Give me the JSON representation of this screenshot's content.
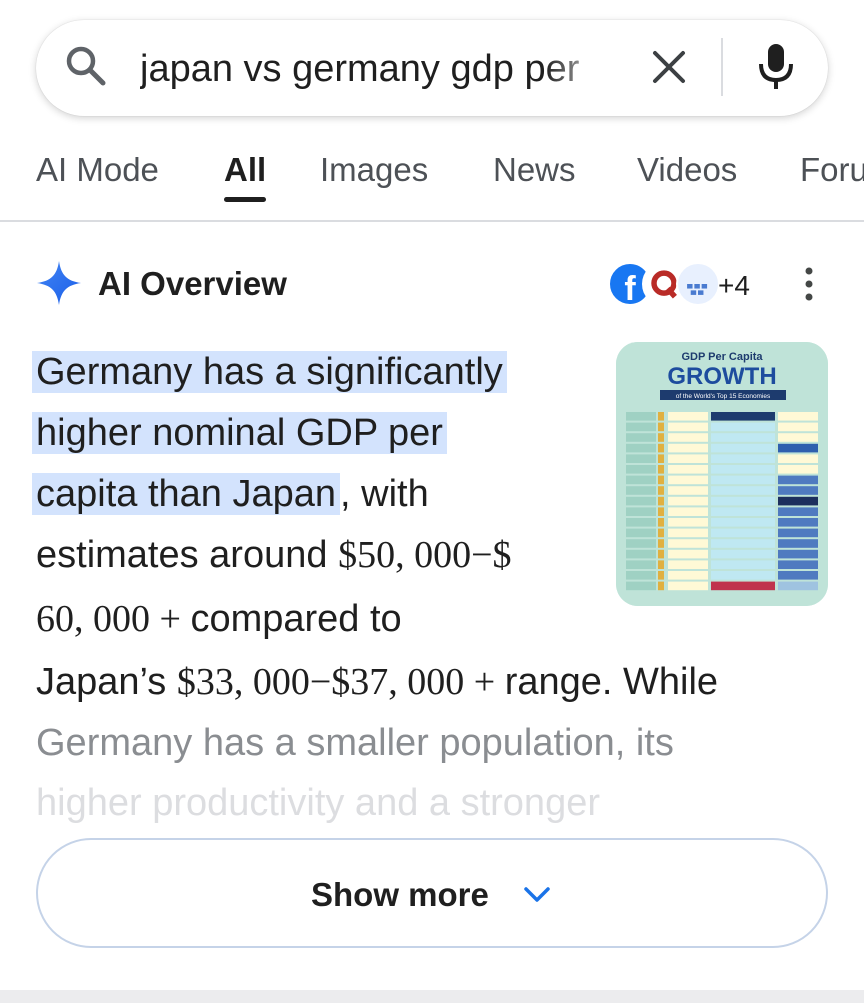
{
  "search": {
    "query": "japan vs germany gdp per",
    "icons": {
      "search": "search-icon",
      "clear": "close-icon",
      "voice": "microphone-icon"
    }
  },
  "tabs": [
    {
      "label": "AI Mode",
      "active": false
    },
    {
      "label": "All",
      "active": true
    },
    {
      "label": "Images",
      "active": false
    },
    {
      "label": "News",
      "active": false
    },
    {
      "label": "Videos",
      "active": false
    },
    {
      "label": "Forums",
      "active": false
    }
  ],
  "ai_overview": {
    "title": "AI Overview",
    "sources_more": "+4",
    "text": {
      "l1": "Germany has a significantly",
      "l2": "higher nominal GDP per",
      "l3a": "capita than Japan",
      "l3b": ", with",
      "l4a": "estimates around ",
      "l4b": "$50, 000−$",
      "l5a": "60, 000 + ",
      "l5b": " compared to",
      "l6a": "Japan’s ",
      "l6b": "$33, 000−$37, 000 + ",
      "l6c": " range. While",
      "l7": "Germany has a smaller population, its",
      "l8": "higher productivity and a stronger"
    },
    "thumbnail": {
      "title_small": "GDP Per Capita",
      "title_big": "GROWTH",
      "subtitle": "of the World's Top 15 Economies"
    },
    "show_more": "Show more"
  },
  "colors": {
    "highlight": "#d3e3fd",
    "accent": "#1a73e8"
  }
}
